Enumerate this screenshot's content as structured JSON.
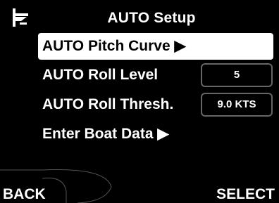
{
  "header": {
    "title": "AUTO Setup",
    "icon": "trim-tab-icon"
  },
  "menu": {
    "items": [
      {
        "label": "AUTO Pitch Curve ▶",
        "selected": true
      },
      {
        "label": "AUTO Roll Level",
        "value": "5"
      },
      {
        "label": "AUTO Roll Thresh.",
        "value": "9.0 KTS"
      },
      {
        "label": "Enter Boat Data ▶"
      }
    ]
  },
  "softkeys": {
    "left": "BACK",
    "right": "SELECT"
  },
  "colors": {
    "background": "#000000",
    "text": "#ffffff",
    "selected_bg": "#ffffff",
    "selected_text": "#000000",
    "value_border": "#666666"
  }
}
